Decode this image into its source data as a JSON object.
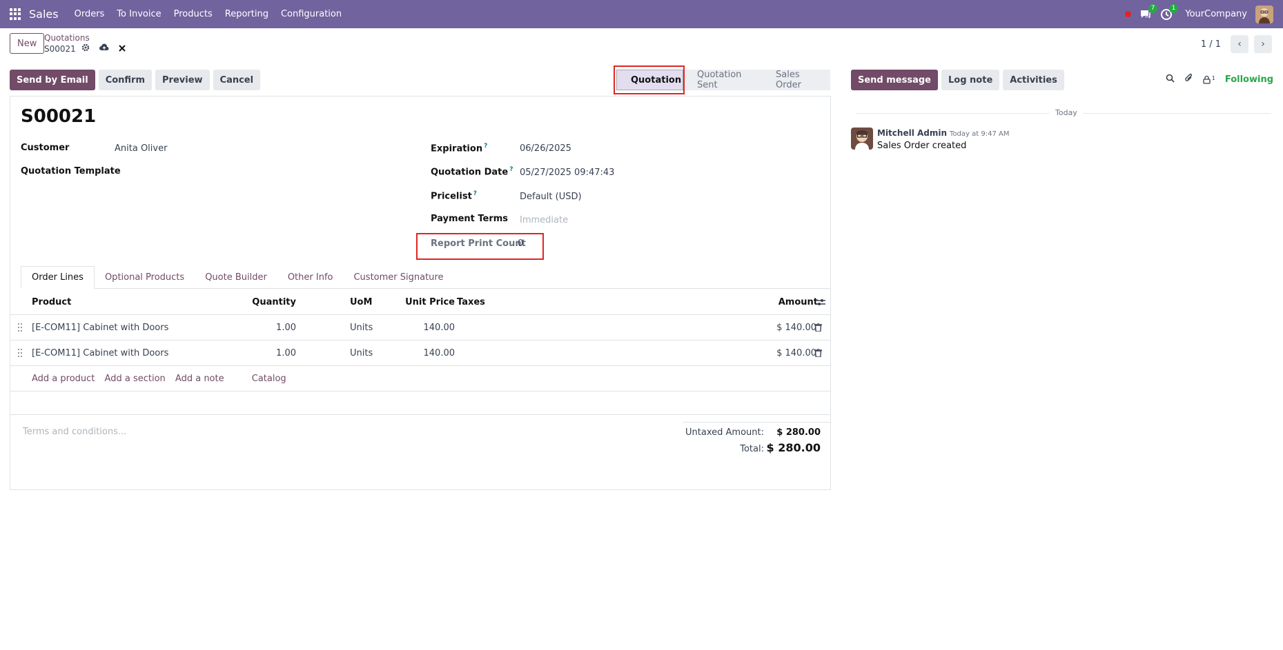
{
  "navbar": {
    "app_name": "Sales",
    "menu": [
      "Orders",
      "To Invoice",
      "Products",
      "Reporting",
      "Configuration"
    ],
    "messages_badge": "7",
    "activities_badge": "1",
    "company": "YourCompany"
  },
  "control_panel": {
    "new_label": "New",
    "breadcrumb_parent": "Quotations",
    "breadcrumb_current": "S00021",
    "pager": "1 / 1"
  },
  "actions": {
    "send_email": "Send by Email",
    "confirm": "Confirm",
    "preview": "Preview",
    "cancel": "Cancel"
  },
  "statusbar": {
    "stages": [
      "Quotation",
      "Quotation Sent",
      "Sales Order"
    ],
    "active": "Quotation"
  },
  "form": {
    "title": "S00021",
    "customer_label": "Customer",
    "customer": "Anita Oliver",
    "template_label": "Quotation Template",
    "expiration_label": "Expiration",
    "expiration": "06/26/2025",
    "quotation_date_label": "Quotation Date",
    "quotation_date": "05/27/2025 09:47:43",
    "pricelist_label": "Pricelist",
    "pricelist": "Default (USD)",
    "payment_terms_label": "Payment Terms",
    "payment_terms_placeholder": "Immediate",
    "report_print_count_label": "Report Print Count",
    "report_print_count": "0",
    "help_mark": "?"
  },
  "tabs": [
    "Order Lines",
    "Optional Products",
    "Quote Builder",
    "Other Info",
    "Customer Signature"
  ],
  "order_lines": {
    "headers": {
      "product": "Product",
      "quantity": "Quantity",
      "uom": "UoM",
      "unit_price": "Unit Price",
      "taxes": "Taxes",
      "amount": "Amount"
    },
    "rows": [
      {
        "product": "[E-COM11] Cabinet with Doors",
        "quantity": "1.00",
        "uom": "Units",
        "unit_price": "140.00",
        "taxes": "",
        "amount": "$ 140.00"
      },
      {
        "product": "[E-COM11] Cabinet with Doors",
        "quantity": "1.00",
        "uom": "Units",
        "unit_price": "140.00",
        "taxes": "",
        "amount": "$ 140.00"
      }
    ],
    "add_links": {
      "product": "Add a product",
      "section": "Add a section",
      "note": "Add a note",
      "catalog": "Catalog"
    }
  },
  "footer": {
    "terms_placeholder": "Terms and conditions...",
    "untaxed_label": "Untaxed Amount:",
    "untaxed_value": "$ 280.00",
    "total_label": "Total:",
    "total_value": "$ 280.00"
  },
  "chatter": {
    "send_message": "Send message",
    "log_note": "Log note",
    "activities": "Activities",
    "followers_count": "1",
    "following": "Following",
    "date_separator": "Today",
    "messages": [
      {
        "author": "Mitchell Admin",
        "time": "Today at 9:47 AM",
        "body": "Sales Order created"
      }
    ]
  },
  "colors": {
    "navbar": "#71639E",
    "primary": "#714B67",
    "highlight": "#e02424",
    "following": "#28a745"
  }
}
